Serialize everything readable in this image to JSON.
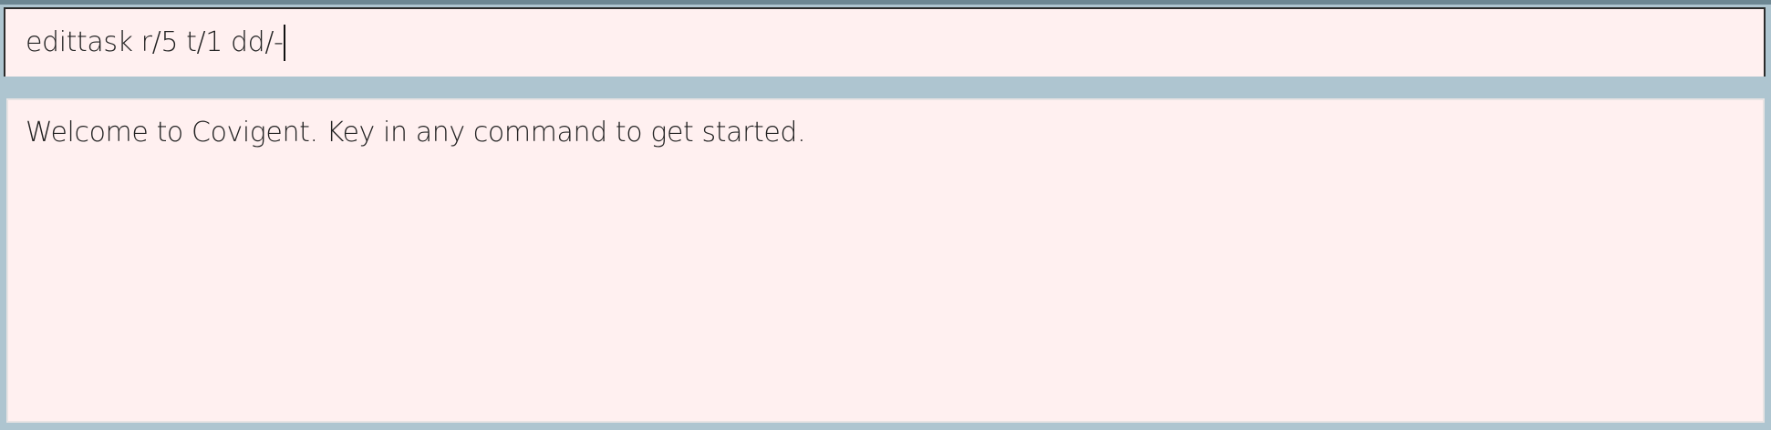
{
  "command_box": {
    "value": "edittask r/5 t/1 dd/-"
  },
  "result_display": {
    "text": "Welcome to Covigent. Key in any command to get started."
  },
  "colors": {
    "background": "#aec5d0",
    "panel": "#fff0f0",
    "text": "#222222"
  }
}
